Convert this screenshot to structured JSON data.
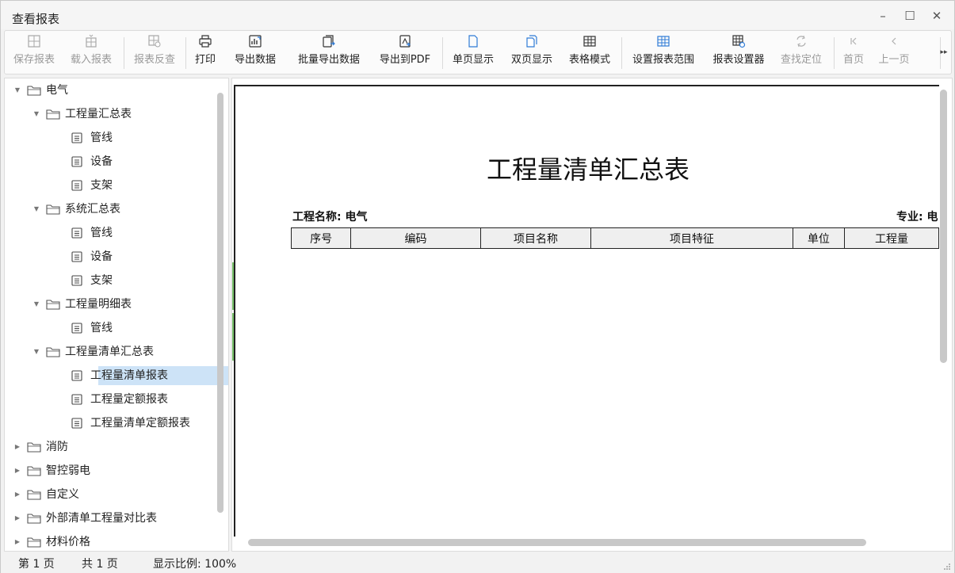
{
  "window": {
    "title": "查看报表",
    "minimize": "–",
    "maximize": "☐",
    "close": "✕"
  },
  "toolbar": {
    "buttons": [
      {
        "label": "保存报表",
        "icon": "grid-icon",
        "enabled": false
      },
      {
        "label": "载入报表",
        "icon": "grid-load-icon",
        "enabled": false
      },
      {
        "label": "报表反查",
        "icon": "grid-search-icon",
        "enabled": false
      },
      {
        "label": "打印",
        "icon": "printer-icon",
        "enabled": true
      },
      {
        "label": "导出数据",
        "icon": "export-data-icon",
        "enabled": true
      },
      {
        "label": "批量导出数据",
        "icon": "batch-export-icon",
        "enabled": true
      },
      {
        "label": "导出到PDF",
        "icon": "pdf-export-icon",
        "enabled": true
      },
      {
        "label": "单页显示",
        "icon": "single-page-icon",
        "enabled": true
      },
      {
        "label": "双页显示",
        "icon": "double-page-icon",
        "enabled": true
      },
      {
        "label": "表格模式",
        "icon": "table-mode-icon",
        "enabled": true
      },
      {
        "label": "设置报表范围",
        "icon": "range-icon",
        "enabled": true
      },
      {
        "label": "报表设置器",
        "icon": "settings-grid-icon",
        "enabled": true
      },
      {
        "label": "查找定位",
        "icon": "refresh-icon",
        "enabled": false
      },
      {
        "label": "首页",
        "icon": "first-page-icon",
        "enabled": false
      },
      {
        "label": "上一页",
        "icon": "prev-page-icon",
        "enabled": false
      }
    ],
    "more": "▸▸"
  },
  "tree": {
    "items": [
      {
        "label": "电气",
        "level": 0,
        "type": "folder",
        "expanded": true
      },
      {
        "label": "工程量汇总表",
        "level": 1,
        "type": "folder",
        "expanded": true
      },
      {
        "label": "管线",
        "level": 2,
        "type": "doc"
      },
      {
        "label": "设备",
        "level": 2,
        "type": "doc"
      },
      {
        "label": "支架",
        "level": 2,
        "type": "doc"
      },
      {
        "label": "系统汇总表",
        "level": 1,
        "type": "folder",
        "expanded": true
      },
      {
        "label": "管线",
        "level": 2,
        "type": "doc"
      },
      {
        "label": "设备",
        "level": 2,
        "type": "doc"
      },
      {
        "label": "支架",
        "level": 2,
        "type": "doc"
      },
      {
        "label": "工程量明细表",
        "level": 1,
        "type": "folder",
        "expanded": true
      },
      {
        "label": "管线",
        "level": 2,
        "type": "doc"
      },
      {
        "label": "工程量清单汇总表",
        "level": 1,
        "type": "folder",
        "expanded": true
      },
      {
        "label": "工程量清单报表",
        "level": 2,
        "type": "doc",
        "selected": true
      },
      {
        "label": "工程量定额报表",
        "level": 2,
        "type": "doc"
      },
      {
        "label": "工程量清单定额报表",
        "level": 2,
        "type": "doc"
      },
      {
        "label": "消防",
        "level": 0,
        "type": "folder",
        "expanded": false
      },
      {
        "label": "智控弱电",
        "level": 0,
        "type": "folder",
        "expanded": false
      },
      {
        "label": "自定义",
        "level": 0,
        "type": "folder",
        "expanded": false
      },
      {
        "label": "外部清单工程量对比表",
        "level": 0,
        "type": "folder",
        "expanded": false
      },
      {
        "label": "材料价格",
        "level": 0,
        "type": "folder",
        "expanded": false
      }
    ]
  },
  "report": {
    "title": "工程量清单汇总表",
    "project_name": "工程名称: 电气",
    "major": "专业: 电",
    "columns": [
      "序号",
      "编码",
      "项目名称",
      "项目特征",
      "单位",
      "工程量"
    ]
  },
  "status": {
    "page": "第 1 页",
    "total": "共 1 页",
    "zoom": "显示比例: 100%"
  },
  "colors": {
    "selected_bg": "#cde3f7",
    "accent_green": "#78c26a",
    "disabled_text": "#9a9a9a"
  }
}
